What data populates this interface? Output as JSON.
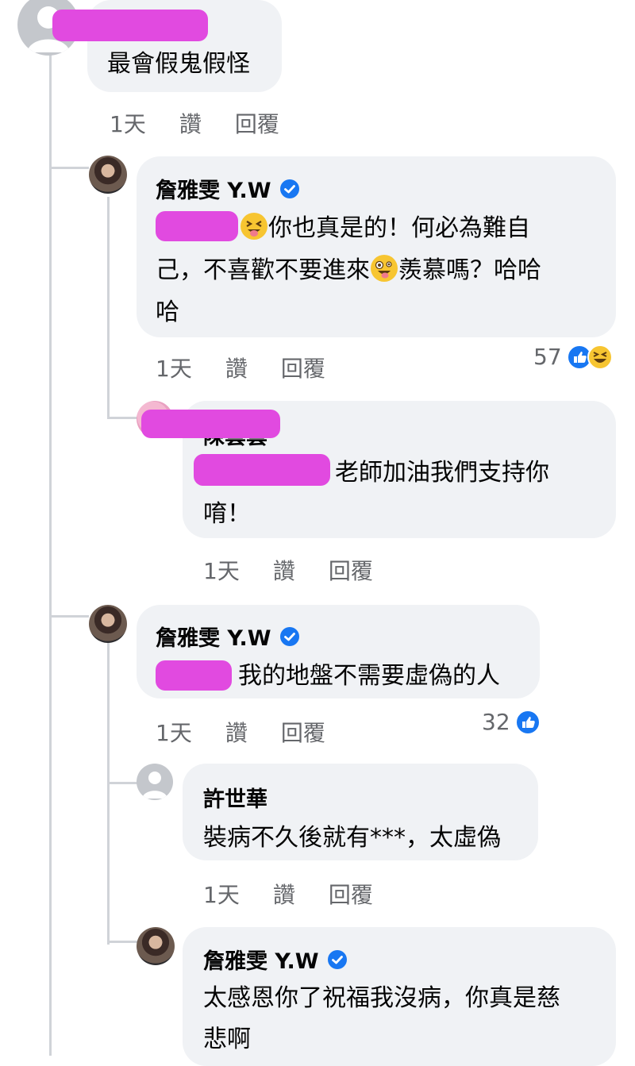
{
  "comments": [
    {
      "id": "c1",
      "author": "",
      "text_lines": [
        "最會假鬼假怪"
      ],
      "meta": {
        "time": "1天",
        "like": "讚",
        "reply": "回覆"
      }
    },
    {
      "id": "c2",
      "author": "詹雅雯 Y.W",
      "verified": true,
      "text_lines": [
        "你也真是的！何必為難自",
        "己，不喜歡不要進來",
        "羨慕嗎？哈哈",
        "哈"
      ],
      "meta": {
        "time": "1天",
        "like": "讚",
        "reply": "回覆"
      },
      "reactions": {
        "count": "57",
        "types": [
          "like",
          "haha"
        ]
      }
    },
    {
      "id": "c3",
      "author_partial": "陳雲雲",
      "text_lines": [
        "老師加油我們支持你",
        "唷！"
      ],
      "meta": {
        "time": "1天",
        "like": "讚",
        "reply": "回覆"
      }
    },
    {
      "id": "c4",
      "author": "詹雅雯 Y.W",
      "verified": true,
      "text_lines": [
        "我的地盤不需要虛偽的人"
      ],
      "meta": {
        "time": "1天",
        "like": "讚",
        "reply": "回覆"
      },
      "reactions": {
        "count": "32",
        "types": [
          "like"
        ]
      }
    },
    {
      "id": "c5",
      "author": "許世華",
      "text_lines": [
        "裝病不久後就有***，太虛偽"
      ],
      "meta": {
        "time": "1天",
        "like": "讚",
        "reply": "回覆"
      }
    },
    {
      "id": "c6",
      "author": "詹雅雯 Y.W",
      "verified": true,
      "text_lines": [
        "太感恩你了祝福我沒病，你真是慈",
        "悲啊"
      ]
    }
  ],
  "colors": {
    "bubble": "#f0f2f5",
    "redaction": "#e14ae0",
    "verified": "#1877f2",
    "meta_text": "#65676b",
    "thread_line": "#d0d3d8"
  }
}
